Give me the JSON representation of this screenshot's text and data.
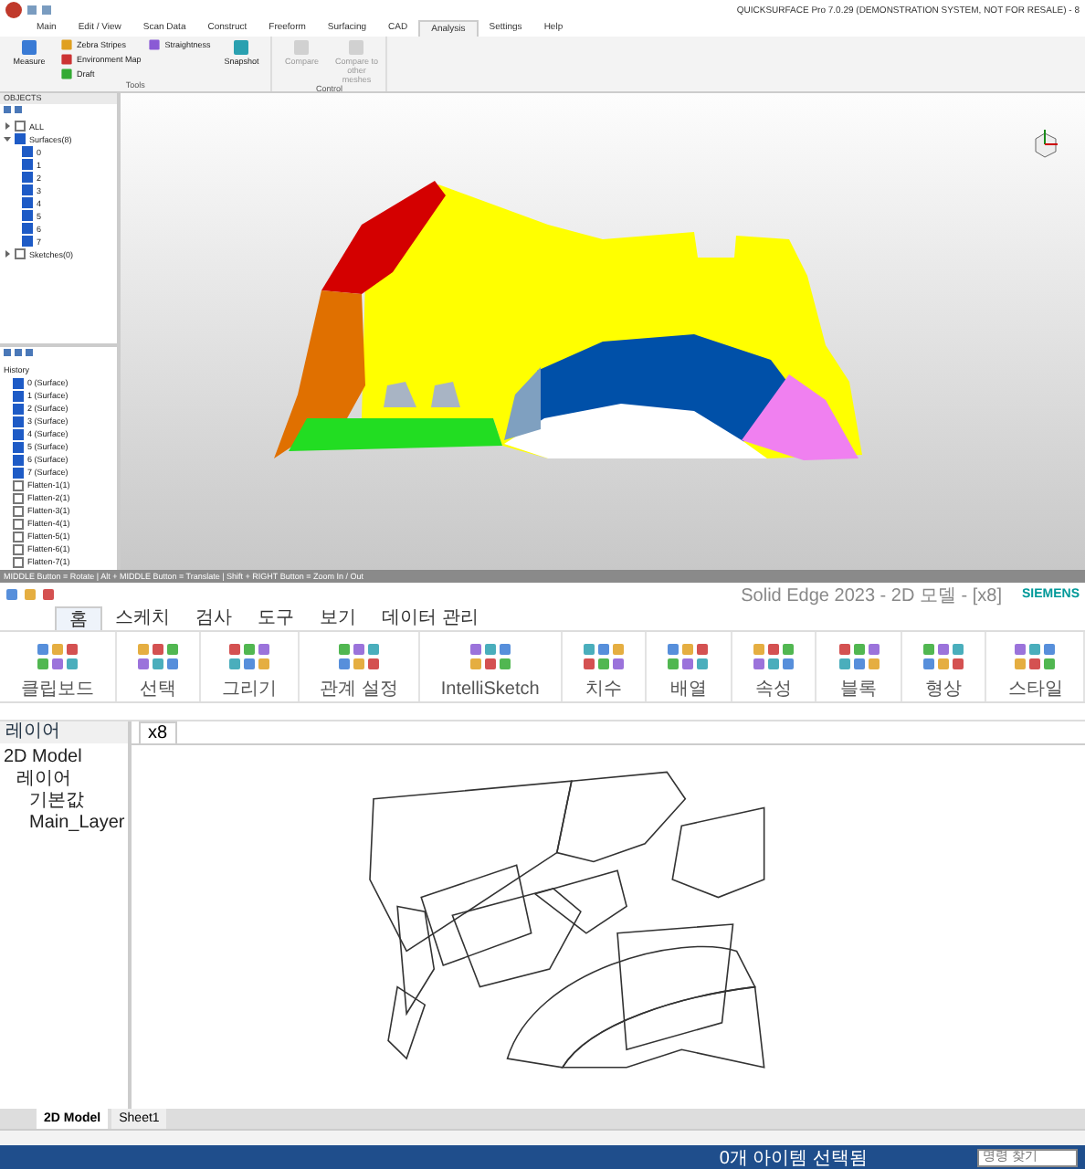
{
  "top_app": {
    "title": "QUICKSURFACE Pro 7.0.29 (DEMONSTRATION SYSTEM, NOT FOR RESALE) - 8",
    "tabs": [
      {
        "label": "Main",
        "selected": false
      },
      {
        "label": "Edit / View",
        "selected": false
      },
      {
        "label": "Scan Data",
        "selected": false
      },
      {
        "label": "Construct",
        "selected": false
      },
      {
        "label": "Freeform",
        "selected": false
      },
      {
        "label": "Surfacing",
        "selected": false
      },
      {
        "label": "CAD",
        "selected": false
      },
      {
        "label": "Analysis",
        "selected": true
      },
      {
        "label": "Settings",
        "selected": false
      },
      {
        "label": "Help",
        "selected": false
      }
    ],
    "ribbon_groups": [
      {
        "label": "Tools",
        "buttons": [
          {
            "label": "Measure",
            "kind": "large",
            "disabled": false
          },
          {
            "label": "Zebra Stripes",
            "kind": "small",
            "disabled": false
          },
          {
            "label": "Environment Map",
            "kind": "small",
            "disabled": false
          },
          {
            "label": "Draft",
            "kind": "small",
            "disabled": false
          },
          {
            "label": "Straightness",
            "kind": "small",
            "disabled": false
          },
          {
            "label": "Snapshot",
            "kind": "large",
            "disabled": false
          }
        ]
      },
      {
        "label": "Control",
        "buttons": [
          {
            "label": "Compare",
            "kind": "large",
            "disabled": true
          },
          {
            "label": "Compare to other meshes",
            "kind": "large",
            "disabled": true
          }
        ]
      }
    ],
    "objects_panel": {
      "title": "OBJECTS",
      "tree": [
        {
          "label": "ALL",
          "checked": false,
          "expanded": false
        },
        {
          "label": "Surfaces(8)",
          "checked": true,
          "expanded": true,
          "children": [
            {
              "label": "0",
              "checked": true
            },
            {
              "label": "1",
              "checked": true
            },
            {
              "label": "2",
              "checked": true
            },
            {
              "label": "3",
              "checked": true
            },
            {
              "label": "4",
              "checked": true
            },
            {
              "label": "5",
              "checked": true
            },
            {
              "label": "6",
              "checked": true
            },
            {
              "label": "7",
              "checked": true
            }
          ]
        },
        {
          "label": "Sketches(0)",
          "checked": false,
          "expanded": false
        }
      ]
    },
    "history_panel": {
      "title": "History",
      "items": [
        {
          "label": "0 (Surface)",
          "checked": true
        },
        {
          "label": "1 (Surface)",
          "checked": true
        },
        {
          "label": "2 (Surface)",
          "checked": true
        },
        {
          "label": "3 (Surface)",
          "checked": true
        },
        {
          "label": "4 (Surface)",
          "checked": true
        },
        {
          "label": "5 (Surface)",
          "checked": true
        },
        {
          "label": "6 (Surface)",
          "checked": true
        },
        {
          "label": "7 (Surface)",
          "checked": true
        },
        {
          "label": "Flatten-1(1)",
          "checked": false
        },
        {
          "label": "Flatten-2(1)",
          "checked": false
        },
        {
          "label": "Flatten-3(1)",
          "checked": false
        },
        {
          "label": "Flatten-4(1)",
          "checked": false
        },
        {
          "label": "Flatten-5(1)",
          "checked": false
        },
        {
          "label": "Flatten-6(1)",
          "checked": false
        },
        {
          "label": "Flatten-7(1)",
          "checked": false
        }
      ]
    }
  },
  "bottom_app": {
    "mouse_hint": "MIDDLE Button = Rotate | Alt + MIDDLE Button = Translate | Shift + RIGHT Button = Zoom In / Out",
    "title": "Solid Edge 2023 - 2D 모델 - [x8]",
    "brand": "SIEMENS",
    "tabs": [
      {
        "label": "홈",
        "selected": true
      },
      {
        "label": "스케치",
        "selected": false
      },
      {
        "label": "검사",
        "selected": false
      },
      {
        "label": "도구",
        "selected": false
      },
      {
        "label": "보기",
        "selected": false
      },
      {
        "label": "데이터 관리",
        "selected": false
      }
    ],
    "ribbon_groups": [
      {
        "label": "클립보드"
      },
      {
        "label": "선택"
      },
      {
        "label": "그리기"
      },
      {
        "label": "관계 설정"
      },
      {
        "label": "IntelliSketch"
      },
      {
        "label": "치수"
      },
      {
        "label": "배열"
      },
      {
        "label": "속성"
      },
      {
        "label": "블록"
      },
      {
        "label": "형상"
      },
      {
        "label": "스타일"
      }
    ],
    "layer_panel": {
      "title": "레이어",
      "tree": [
        {
          "label": "2D Model",
          "children": [
            {
              "label": "레이어",
              "children": [
                {
                  "label": "기본값"
                },
                {
                  "label": "Main_Layer"
                }
              ]
            }
          ]
        }
      ]
    },
    "document_tab": "x8",
    "sheet_tabs": [
      {
        "label": "2D Model",
        "selected": true
      },
      {
        "label": "Sheet1",
        "selected": false
      }
    ],
    "status": "0개 아이템 선택됨",
    "search": {
      "placeholder": "명령 찾기"
    }
  }
}
